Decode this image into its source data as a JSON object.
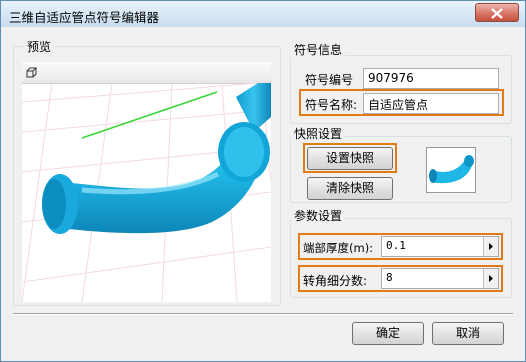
{
  "window": {
    "title": "三维自适应管点符号编辑器"
  },
  "preview": {
    "label": "预览"
  },
  "symbol_info": {
    "label": "符号信息",
    "code_label": "符号编号",
    "code_value": "907976",
    "name_label": "符号名称:",
    "name_value": "自适应管点"
  },
  "snapshot": {
    "label": "快照设置",
    "set_button": "设置快照",
    "clear_button": "清除快照"
  },
  "params": {
    "label": "参数设置",
    "thickness_label": "端部厚度(m):",
    "thickness_value": "0.1",
    "segments_label": "转角细分数:",
    "segments_value": "8"
  },
  "footer": {
    "ok": "确定",
    "cancel": "取消"
  },
  "colors": {
    "accent": "#e07b16",
    "pipe": "#1fb8e6"
  }
}
